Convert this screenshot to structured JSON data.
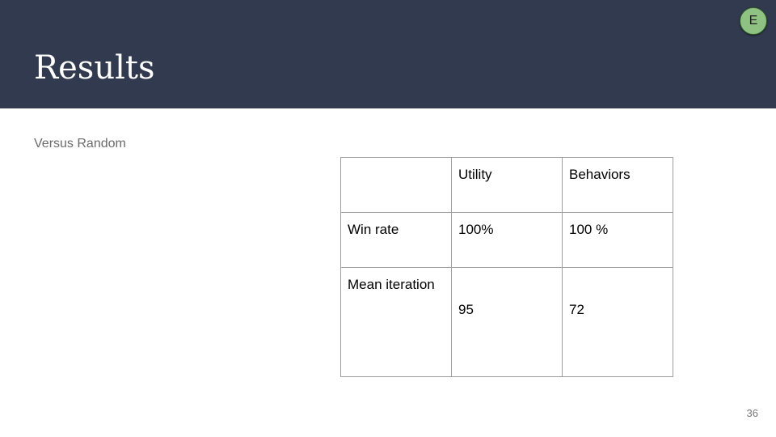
{
  "slide": {
    "title": "Results",
    "subtitle": "Versus Random",
    "page_number": "36",
    "avatar_initial": "E"
  },
  "table": {
    "headers": [
      "",
      "Utility",
      "Behaviors"
    ],
    "rows": [
      [
        "Win rate",
        "100%",
        "100 %"
      ],
      [
        "Mean iteration",
        "95",
        "72"
      ]
    ]
  },
  "colors": {
    "header_bg": "#313a4e",
    "avatar_bg": "#8fc183"
  }
}
